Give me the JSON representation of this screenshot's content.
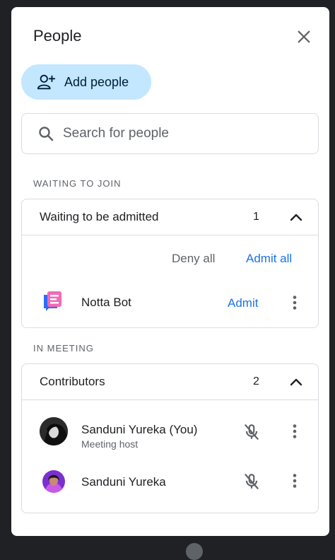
{
  "header": {
    "title": "People"
  },
  "add_people": {
    "label": "Add people"
  },
  "search": {
    "placeholder": "Search for people"
  },
  "waiting": {
    "section_label": "WAITING TO JOIN",
    "group_title": "Waiting to be admitted",
    "count": "1",
    "deny_all": "Deny all",
    "admit_all": "Admit all",
    "person": {
      "name": "Notta Bot",
      "admit": "Admit"
    }
  },
  "meeting": {
    "section_label": "IN MEETING",
    "group_title": "Contributors",
    "count": "2",
    "people": [
      {
        "name": "Sanduni Yureka (You)",
        "role": "Meeting host"
      },
      {
        "name": "Sanduni Yureka"
      }
    ]
  },
  "colors": {
    "accent": "#1a73e8",
    "add_button_bg": "#c2e7ff",
    "border": "#dadce0"
  }
}
